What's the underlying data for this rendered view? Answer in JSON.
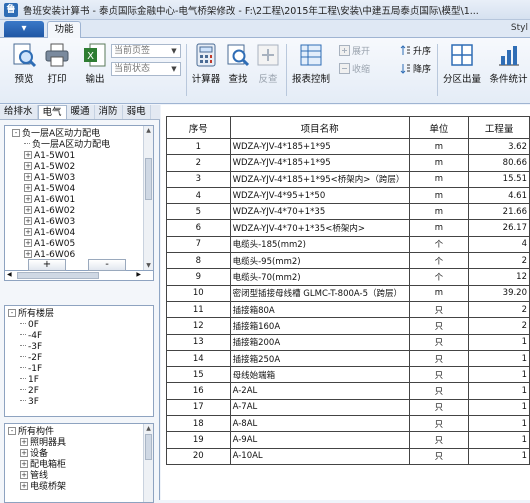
{
  "window": {
    "title": "鲁班安装计算书 - 泰贞国际金融中心-电气桥架修改 - F:\\2工程\\2015年工程\\安装\\中建五局泰贞国际\\模型\\1..."
  },
  "ribbon": {
    "file_tab": "",
    "func_tab": "功能",
    "style_label": "Styl",
    "buttons": {
      "preview": "预览",
      "print": "打印",
      "export": "输出",
      "calculator": "计算器",
      "find": "查找",
      "review": "反查",
      "report_control": "报表控制",
      "sort_asc": "升序",
      "sort_desc": "降序",
      "expand": "展开",
      "collapse": "收缩",
      "zone_output": "分区出量",
      "condition_stats": "条件统计"
    },
    "combos": {
      "page_sign": "当前页签",
      "state": "当前状态"
    }
  },
  "left_panel": {
    "tabs": [
      "给排水",
      "电气",
      "暖通",
      "消防",
      "弱电"
    ],
    "active_tab": "电气",
    "tree1": [
      {
        "label": "负一层A区动力配电",
        "level": 0,
        "toggle": "-"
      },
      {
        "label": "负一层A区动力配电",
        "level": 1,
        "toggle": ""
      },
      {
        "label": "A1-5W01",
        "level": 1,
        "toggle": "+"
      },
      {
        "label": "A1-5W02",
        "level": 1,
        "toggle": "+"
      },
      {
        "label": "A1-5W03",
        "level": 1,
        "toggle": "+"
      },
      {
        "label": "A1-5W04",
        "level": 1,
        "toggle": "+"
      },
      {
        "label": "A1-6W01",
        "level": 1,
        "toggle": "+"
      },
      {
        "label": "A1-6W02",
        "level": 1,
        "toggle": "+"
      },
      {
        "label": "A1-6W03",
        "level": 1,
        "toggle": "+"
      },
      {
        "label": "A1-6W04",
        "level": 1,
        "toggle": "+"
      },
      {
        "label": "A1-6W05",
        "level": 1,
        "toggle": "+"
      },
      {
        "label": "A1-6W06",
        "level": 1,
        "toggle": "+"
      }
    ],
    "add_label": "+",
    "remove_label": "-",
    "floors_title": "所有楼层",
    "floors": [
      "0F",
      "-4F",
      "-3F",
      "-2F",
      "-1F",
      "1F",
      "2F",
      "3F"
    ],
    "components_title": "所有构件",
    "components": [
      "照明器具",
      "设备",
      "配电箱柜",
      "管线",
      "电缆桥架"
    ]
  },
  "table": {
    "headers": [
      "序号",
      "项目名称",
      "单位",
      "工程量"
    ],
    "rows": [
      {
        "no": "1",
        "name": "WDZA-YJV-4*185+1*95",
        "unit": "m",
        "qty": "3.62"
      },
      {
        "no": "2",
        "name": "WDZA-YJV-4*185+1*95",
        "unit": "m",
        "qty": "80.66"
      },
      {
        "no": "3",
        "name": "WDZA-YJV-4*185+1*95<桥架内>（跨层）",
        "unit": "m",
        "qty": "15.51"
      },
      {
        "no": "4",
        "name": "WDZA-YJV-4*95+1*50",
        "unit": "m",
        "qty": "4.61"
      },
      {
        "no": "5",
        "name": "WDZA-YJV-4*70+1*35",
        "unit": "m",
        "qty": "21.66"
      },
      {
        "no": "6",
        "name": "WDZA-YJV-4*70+1*35<桥架内>",
        "unit": "m",
        "qty": "26.17"
      },
      {
        "no": "7",
        "name": "电缆头-185(mm2)",
        "unit": "个",
        "qty": "4"
      },
      {
        "no": "8",
        "name": "电缆头-95(mm2)",
        "unit": "个",
        "qty": "2"
      },
      {
        "no": "9",
        "name": "电缆头-70(mm2)",
        "unit": "个",
        "qty": "12"
      },
      {
        "no": "10",
        "name": "密闭型插接母线槽 GLMC-T-800A-5（跨层）",
        "unit": "m",
        "qty": "39.20"
      },
      {
        "no": "11",
        "name": "插接箱80A",
        "unit": "只",
        "qty": "2"
      },
      {
        "no": "12",
        "name": "插接箱160A",
        "unit": "只",
        "qty": "2"
      },
      {
        "no": "13",
        "name": "插接箱200A",
        "unit": "只",
        "qty": "1"
      },
      {
        "no": "14",
        "name": "插接箱250A",
        "unit": "只",
        "qty": "1"
      },
      {
        "no": "15",
        "name": "母线始端箱",
        "unit": "只",
        "qty": "1"
      },
      {
        "no": "16",
        "name": "A-2AL",
        "unit": "只",
        "qty": "1"
      },
      {
        "no": "17",
        "name": "A-7AL",
        "unit": "只",
        "qty": "1"
      },
      {
        "no": "18",
        "name": "A-8AL",
        "unit": "只",
        "qty": "1"
      },
      {
        "no": "19",
        "name": "A-9AL",
        "unit": "只",
        "qty": "1"
      },
      {
        "no": "20",
        "name": "A-10AL",
        "unit": "只",
        "qty": "1"
      }
    ]
  },
  "colors": {
    "ribbon_accent": "#1f57a4",
    "icon_blue": "#2f6db5",
    "icon_red": "#c0392b"
  }
}
